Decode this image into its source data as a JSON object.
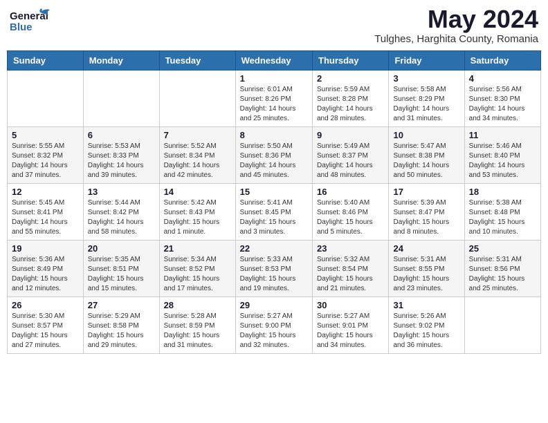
{
  "header": {
    "logo_line1": "General",
    "logo_line2": "Blue",
    "month": "May 2024",
    "location": "Tulghes, Harghita County, Romania"
  },
  "weekdays": [
    "Sunday",
    "Monday",
    "Tuesday",
    "Wednesday",
    "Thursday",
    "Friday",
    "Saturday"
  ],
  "weeks": [
    [
      {
        "day": "",
        "info": ""
      },
      {
        "day": "",
        "info": ""
      },
      {
        "day": "",
        "info": ""
      },
      {
        "day": "1",
        "info": "Sunrise: 6:01 AM\nSunset: 8:26 PM\nDaylight: 14 hours\nand 25 minutes."
      },
      {
        "day": "2",
        "info": "Sunrise: 5:59 AM\nSunset: 8:28 PM\nDaylight: 14 hours\nand 28 minutes."
      },
      {
        "day": "3",
        "info": "Sunrise: 5:58 AM\nSunset: 8:29 PM\nDaylight: 14 hours\nand 31 minutes."
      },
      {
        "day": "4",
        "info": "Sunrise: 5:56 AM\nSunset: 8:30 PM\nDaylight: 14 hours\nand 34 minutes."
      }
    ],
    [
      {
        "day": "5",
        "info": "Sunrise: 5:55 AM\nSunset: 8:32 PM\nDaylight: 14 hours\nand 37 minutes."
      },
      {
        "day": "6",
        "info": "Sunrise: 5:53 AM\nSunset: 8:33 PM\nDaylight: 14 hours\nand 39 minutes."
      },
      {
        "day": "7",
        "info": "Sunrise: 5:52 AM\nSunset: 8:34 PM\nDaylight: 14 hours\nand 42 minutes."
      },
      {
        "day": "8",
        "info": "Sunrise: 5:50 AM\nSunset: 8:36 PM\nDaylight: 14 hours\nand 45 minutes."
      },
      {
        "day": "9",
        "info": "Sunrise: 5:49 AM\nSunset: 8:37 PM\nDaylight: 14 hours\nand 48 minutes."
      },
      {
        "day": "10",
        "info": "Sunrise: 5:47 AM\nSunset: 8:38 PM\nDaylight: 14 hours\nand 50 minutes."
      },
      {
        "day": "11",
        "info": "Sunrise: 5:46 AM\nSunset: 8:40 PM\nDaylight: 14 hours\nand 53 minutes."
      }
    ],
    [
      {
        "day": "12",
        "info": "Sunrise: 5:45 AM\nSunset: 8:41 PM\nDaylight: 14 hours\nand 55 minutes."
      },
      {
        "day": "13",
        "info": "Sunrise: 5:44 AM\nSunset: 8:42 PM\nDaylight: 14 hours\nand 58 minutes."
      },
      {
        "day": "14",
        "info": "Sunrise: 5:42 AM\nSunset: 8:43 PM\nDaylight: 15 hours\nand 1 minute."
      },
      {
        "day": "15",
        "info": "Sunrise: 5:41 AM\nSunset: 8:45 PM\nDaylight: 15 hours\nand 3 minutes."
      },
      {
        "day": "16",
        "info": "Sunrise: 5:40 AM\nSunset: 8:46 PM\nDaylight: 15 hours\nand 5 minutes."
      },
      {
        "day": "17",
        "info": "Sunrise: 5:39 AM\nSunset: 8:47 PM\nDaylight: 15 hours\nand 8 minutes."
      },
      {
        "day": "18",
        "info": "Sunrise: 5:38 AM\nSunset: 8:48 PM\nDaylight: 15 hours\nand 10 minutes."
      }
    ],
    [
      {
        "day": "19",
        "info": "Sunrise: 5:36 AM\nSunset: 8:49 PM\nDaylight: 15 hours\nand 12 minutes."
      },
      {
        "day": "20",
        "info": "Sunrise: 5:35 AM\nSunset: 8:51 PM\nDaylight: 15 hours\nand 15 minutes."
      },
      {
        "day": "21",
        "info": "Sunrise: 5:34 AM\nSunset: 8:52 PM\nDaylight: 15 hours\nand 17 minutes."
      },
      {
        "day": "22",
        "info": "Sunrise: 5:33 AM\nSunset: 8:53 PM\nDaylight: 15 hours\nand 19 minutes."
      },
      {
        "day": "23",
        "info": "Sunrise: 5:32 AM\nSunset: 8:54 PM\nDaylight: 15 hours\nand 21 minutes."
      },
      {
        "day": "24",
        "info": "Sunrise: 5:31 AM\nSunset: 8:55 PM\nDaylight: 15 hours\nand 23 minutes."
      },
      {
        "day": "25",
        "info": "Sunrise: 5:31 AM\nSunset: 8:56 PM\nDaylight: 15 hours\nand 25 minutes."
      }
    ],
    [
      {
        "day": "26",
        "info": "Sunrise: 5:30 AM\nSunset: 8:57 PM\nDaylight: 15 hours\nand 27 minutes."
      },
      {
        "day": "27",
        "info": "Sunrise: 5:29 AM\nSunset: 8:58 PM\nDaylight: 15 hours\nand 29 minutes."
      },
      {
        "day": "28",
        "info": "Sunrise: 5:28 AM\nSunset: 8:59 PM\nDaylight: 15 hours\nand 31 minutes."
      },
      {
        "day": "29",
        "info": "Sunrise: 5:27 AM\nSunset: 9:00 PM\nDaylight: 15 hours\nand 32 minutes."
      },
      {
        "day": "30",
        "info": "Sunrise: 5:27 AM\nSunset: 9:01 PM\nDaylight: 15 hours\nand 34 minutes."
      },
      {
        "day": "31",
        "info": "Sunrise: 5:26 AM\nSunset: 9:02 PM\nDaylight: 15 hours\nand 36 minutes."
      },
      {
        "day": "",
        "info": ""
      }
    ]
  ]
}
